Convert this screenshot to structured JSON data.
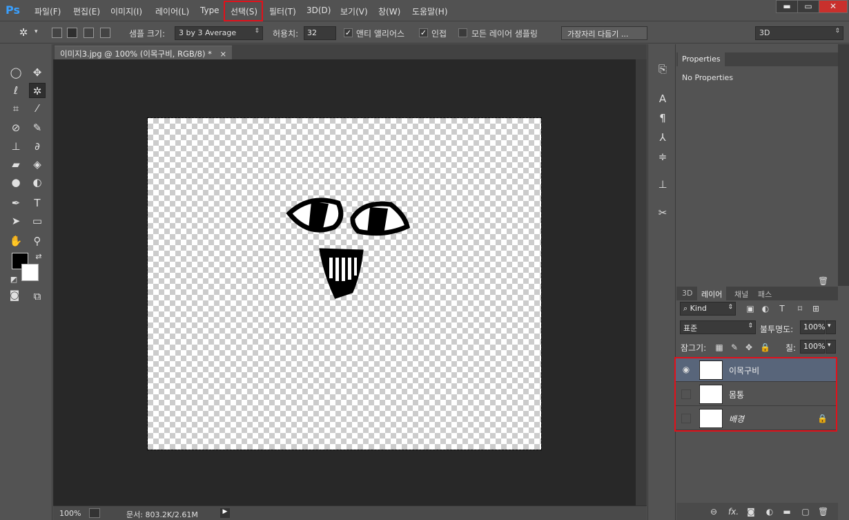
{
  "app": {
    "logo": "Ps"
  },
  "menu": [
    "파일(F)",
    "편집(E)",
    "이미지(I)",
    "레이어(L)",
    "Type",
    "선택(S)",
    "필터(T)",
    "3D(D)",
    "보기(V)",
    "창(W)",
    "도움말(H)"
  ],
  "window_controls": {
    "minimize": "▬",
    "maximize": "▭",
    "close": "✕"
  },
  "options": {
    "sample_size_label": "샘플 크기:",
    "sample_size_value": "3 by 3 Average",
    "tolerance_label": "허용치:",
    "tolerance_value": "32",
    "antialias_label": "앤티 앨리어스",
    "antialias_checked": "✓",
    "contiguous_label": "인접",
    "contiguous_checked": "✓",
    "sample_all_label": "모든 레이어 샘플링",
    "refine_edge_button": "가장자리 다듬기 ...",
    "workspace_value": "3D"
  },
  "document": {
    "tab_title": "이미지3.jpg @ 100% (이목구비, RGB/8) *",
    "tab_close": "×",
    "zoom": "100%",
    "doc_info": "문서: 803.2K/2.61M"
  },
  "properties": {
    "tab": "Properties",
    "content": "No Properties"
  },
  "layers_panel": {
    "tabs": [
      "3D",
      "레이어",
      "채널",
      "패스"
    ],
    "filter_label": "Kind",
    "blend_mode": "표준",
    "opacity_label": "불투명도:",
    "opacity_value": "100%",
    "lock_label": "잠그기:",
    "fill_label": "칠:",
    "fill_value": "100%",
    "layers": [
      {
        "name": "이목구비",
        "visible": "◉"
      },
      {
        "name": "몸통",
        "visible": ""
      },
      {
        "name": "배경",
        "visible": ""
      }
    ],
    "footer_fx": "fx."
  }
}
